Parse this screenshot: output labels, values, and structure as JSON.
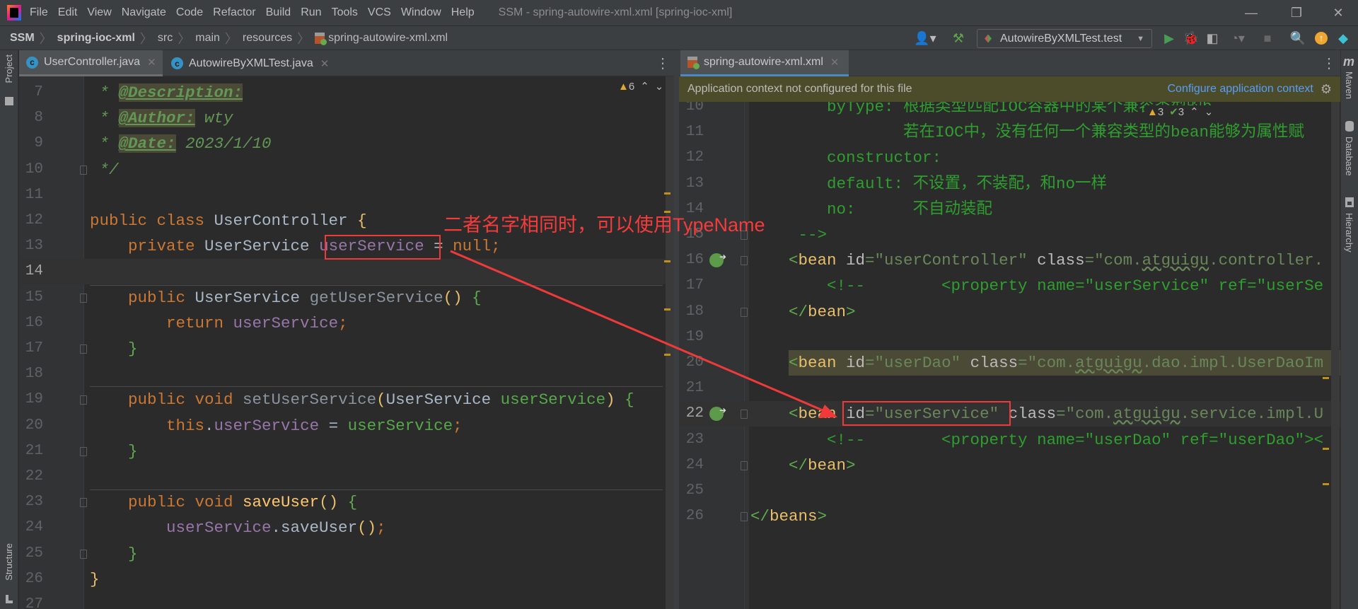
{
  "app": {
    "menu": [
      "File",
      "Edit",
      "View",
      "Navigate",
      "Code",
      "Refactor",
      "Build",
      "Run",
      "Tools",
      "VCS",
      "Window",
      "Help"
    ],
    "window_title": "SSM - spring-autowire-xml.xml [spring-ioc-xml]",
    "window_controls": {
      "minimize": "—",
      "maximize": "❐",
      "close": "✕"
    }
  },
  "breadcrumb": [
    "SSM",
    "spring-ioc-xml",
    "src",
    "main",
    "resources",
    "spring-autowire-xml.xml"
  ],
  "toolbar": {
    "run_config": "AutowireByXMLTest.test",
    "icons": [
      "user-icon",
      "hammer-icon",
      "run-icon",
      "debug-icon",
      "coverage-icon",
      "profile-icon",
      "stop-icon",
      "search-icon",
      "update-icon",
      "toolbox-logo-icon"
    ]
  },
  "left_strip": {
    "top": "Project",
    "bottom": "Structure"
  },
  "right_strip": [
    "Maven",
    "Database",
    "Hierarchy"
  ],
  "left_editor": {
    "tabs": [
      {
        "label": "UserController.java",
        "active": true
      },
      {
        "label": "AutowireByXMLTest.java",
        "active": false
      }
    ],
    "warnings": "6",
    "current_line": 14,
    "lines": [
      {
        "n": "7",
        "t": [
          [
            " * ",
            "doc"
          ],
          [
            "@Description:",
            "doctag"
          ]
        ]
      },
      {
        "n": "8",
        "t": [
          [
            " * ",
            "doc"
          ],
          [
            "@Author:",
            "doctag"
          ],
          [
            " wty",
            "doc"
          ]
        ]
      },
      {
        "n": "9",
        "t": [
          [
            " * ",
            "doc"
          ],
          [
            "@Date:",
            "doctag"
          ],
          [
            " 2023/1/10",
            "doc"
          ]
        ]
      },
      {
        "n": "10",
        "t": [
          [
            " */",
            "doc"
          ]
        ]
      },
      {
        "n": "11",
        "t": []
      },
      {
        "n": "12",
        "t": [
          [
            "public class ",
            "kw"
          ],
          [
            "UserController ",
            "cls"
          ],
          [
            "{",
            "bry"
          ]
        ]
      },
      {
        "n": "13",
        "t": [
          [
            "    private ",
            "kw"
          ],
          [
            "UserService ",
            "cls"
          ],
          [
            "userService",
            "fld"
          ],
          [
            " = ",
            "plain"
          ],
          [
            "null",
            "kw"
          ],
          [
            ";",
            "kw"
          ]
        ]
      },
      {
        "n": "14",
        "t": []
      },
      {
        "n": "15",
        "t": [
          [
            "    public ",
            "kw"
          ],
          [
            "UserService ",
            "cls"
          ],
          [
            "getUserService",
            "mname"
          ],
          [
            "()",
            "bry"
          ],
          [
            " {",
            "brg"
          ]
        ]
      },
      {
        "n": "16",
        "t": [
          [
            "        return ",
            "kw"
          ],
          [
            "userService",
            "fld"
          ],
          [
            ";",
            "kw"
          ]
        ]
      },
      {
        "n": "17",
        "t": [
          [
            "    }",
            "brg"
          ]
        ]
      },
      {
        "n": "18",
        "t": []
      },
      {
        "n": "19",
        "t": [
          [
            "    public void ",
            "kw"
          ],
          [
            "setUserService",
            "mname"
          ],
          [
            "(",
            "bry"
          ],
          [
            "UserService ",
            "cls"
          ],
          [
            "userService",
            "prm"
          ],
          [
            ")",
            "bry"
          ],
          [
            " {",
            "brg"
          ]
        ]
      },
      {
        "n": "20",
        "t": [
          [
            "        this",
            "kw"
          ],
          [
            ".",
            "plain"
          ],
          [
            "userService",
            "fld"
          ],
          [
            " = ",
            "plain"
          ],
          [
            "userService",
            "prm"
          ],
          [
            ";",
            "kw"
          ]
        ]
      },
      {
        "n": "21",
        "t": [
          [
            "    }",
            "brg"
          ]
        ]
      },
      {
        "n": "22",
        "t": []
      },
      {
        "n": "23",
        "t": [
          [
            "    public void ",
            "kw"
          ],
          [
            "saveUser",
            "mth"
          ],
          [
            "()",
            "bry"
          ],
          [
            " {",
            "brg"
          ]
        ]
      },
      {
        "n": "24",
        "t": [
          [
            "        userService",
            "fld"
          ],
          [
            ".saveUser",
            "plain"
          ],
          [
            "()",
            "bry"
          ],
          [
            ";",
            "kw"
          ]
        ]
      },
      {
        "n": "25",
        "t": [
          [
            "    }",
            "brg"
          ]
        ]
      },
      {
        "n": "26",
        "t": [
          [
            "}",
            "bry"
          ]
        ]
      },
      {
        "n": "27",
        "t": []
      }
    ]
  },
  "right_editor": {
    "tabs": [
      {
        "label": "spring-autowire-xml.xml",
        "active": true
      }
    ],
    "banner": {
      "text": "Application context not configured for this file",
      "link": "Configure application context"
    },
    "warnings": "3",
    "weak_warnings": "3",
    "current_line": 22,
    "lines": [
      {
        "n": "10",
        "t": [
          [
            "        byType: 根据类型匹配IOC容器中的某个兼容类型的b",
            "xc"
          ]
        ]
      },
      {
        "n": "11",
        "t": [
          [
            "                若在IOC中，没有任何一个兼容类型的bean能够为属性赋",
            "xc"
          ]
        ]
      },
      {
        "n": "12",
        "t": [
          [
            "        constructor:",
            "xc"
          ]
        ]
      },
      {
        "n": "13",
        "t": [
          [
            "        default: 不设置，不装配，和no一样",
            "xc"
          ]
        ]
      },
      {
        "n": "14",
        "t": [
          [
            "        no:      不自动装配",
            "xc"
          ]
        ]
      },
      {
        "n": "15",
        "t": [
          [
            "     -->",
            "xc"
          ]
        ]
      },
      {
        "n": "16",
        "t": [
          [
            "    <",
            "tagb"
          ],
          [
            "bean ",
            "tag"
          ],
          [
            "id",
            "attr"
          ],
          [
            "=\"userController\" ",
            "val"
          ],
          [
            "class",
            "attr"
          ],
          [
            "=\"com.",
            "val"
          ],
          [
            "atguigu",
            "val wavy"
          ],
          [
            ".controller.",
            "val"
          ]
        ]
      },
      {
        "n": "17",
        "t": [
          [
            "        <!--        <property name=\"userService\" ref=\"userSe",
            "xc"
          ]
        ]
      },
      {
        "n": "18",
        "t": [
          [
            "    </",
            "tagb"
          ],
          [
            "bean",
            "tag"
          ],
          [
            ">",
            "tagb"
          ]
        ]
      },
      {
        "n": "19",
        "t": []
      },
      {
        "n": "20",
        "t": [
          [
            "    <",
            "tagb"
          ],
          [
            "bean ",
            "tag"
          ],
          [
            "id",
            "attr"
          ],
          [
            "=\"userDao\" ",
            "val"
          ],
          [
            "class",
            "attr"
          ],
          [
            "=\"com.",
            "val"
          ],
          [
            "atguigu",
            "val wavy"
          ],
          [
            ".dao.impl.UserDaoIm",
            "val"
          ]
        ]
      },
      {
        "n": "21",
        "t": []
      },
      {
        "n": "22",
        "t": [
          [
            "    <",
            "tagb"
          ],
          [
            "bean ",
            "tag"
          ],
          [
            "id",
            "attr"
          ],
          [
            "=\"userService\" ",
            "val"
          ],
          [
            "class",
            "attr"
          ],
          [
            "=\"com.",
            "val"
          ],
          [
            "atguigu",
            "val wavy"
          ],
          [
            ".service.impl.U",
            "val"
          ]
        ]
      },
      {
        "n": "23",
        "t": [
          [
            "        <!--        <property name=\"userDao\" ref=\"userDao\"><",
            "xc"
          ]
        ]
      },
      {
        "n": "24",
        "t": [
          [
            "    </",
            "tagb"
          ],
          [
            "bean",
            "tag"
          ],
          [
            ">",
            "tagb"
          ]
        ]
      },
      {
        "n": "25",
        "t": []
      },
      {
        "n": "26",
        "t": [
          [
            "</",
            "tagb"
          ],
          [
            "beans",
            "tag"
          ],
          [
            ">",
            "tagb"
          ]
        ]
      }
    ]
  },
  "annotation": {
    "note": "二者名字相同时，可以使用TypeName",
    "color": "#f03a3a"
  }
}
